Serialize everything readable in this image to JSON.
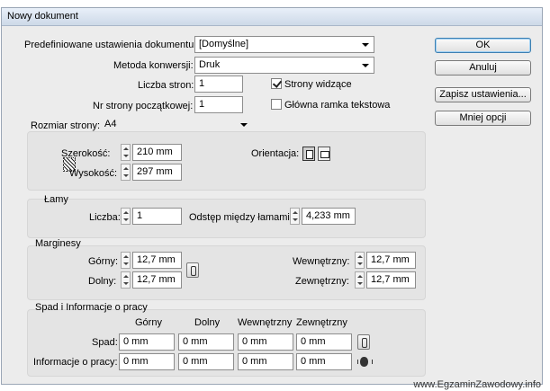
{
  "dialog": {
    "title": "Nowy dokument"
  },
  "top": {
    "preset_label": "Predefiniowane ustawienia dokumentu:",
    "preset_value": "[Domyślne]",
    "method_label": "Metoda konwersji:",
    "method_value": "Druk",
    "pages_label": "Liczba stron:",
    "pages_value": "1",
    "start_label": "Nr strony początkowej:",
    "start_value": "1",
    "facing_label": "Strony widzące",
    "facing_checked": true,
    "master_label": "Główna ramka tekstowa",
    "master_checked": false
  },
  "buttons": {
    "ok": "OK",
    "cancel": "Anuluj",
    "save": "Zapisz ustawienia...",
    "fewer": "Mniej opcji"
  },
  "page_size": {
    "label": "Rozmiar strony:",
    "value": "A4",
    "width_label": "Szerokość:",
    "width_value": "210 mm",
    "height_label": "Wysokość:",
    "height_value": "297 mm",
    "orientation_label": "Orientacja:"
  },
  "columns": {
    "title": "Łamy",
    "count_label": "Liczba:",
    "count_value": "1",
    "gutter_label": "Odstęp między łamami:",
    "gutter_value": "4,233 mm"
  },
  "margins": {
    "title": "Marginesy",
    "top_label": "Górny:",
    "top_value": "12,7 mm",
    "bottom_label": "Dolny:",
    "bottom_value": "12,7 mm",
    "inside_label": "Wewnętrzny:",
    "inside_value": "12,7 mm",
    "outside_label": "Zewnętrzny:",
    "outside_value": "12,7 mm"
  },
  "bleed": {
    "title": "Spad i Informacje o pracy",
    "headers": [
      "Górny",
      "Dolny",
      "Wewnętrzny",
      "Zewnętrzny"
    ],
    "bleed_label": "Spad:",
    "bleed_values": [
      "0 mm",
      "0 mm",
      "0 mm",
      "0 mm"
    ],
    "slug_label": "Informacje o pracy:",
    "slug_values": [
      "0 mm",
      "0 mm",
      "0 mm",
      "0 mm"
    ]
  },
  "footer": {
    "text": "www.EgzaminZawodowy.info"
  }
}
